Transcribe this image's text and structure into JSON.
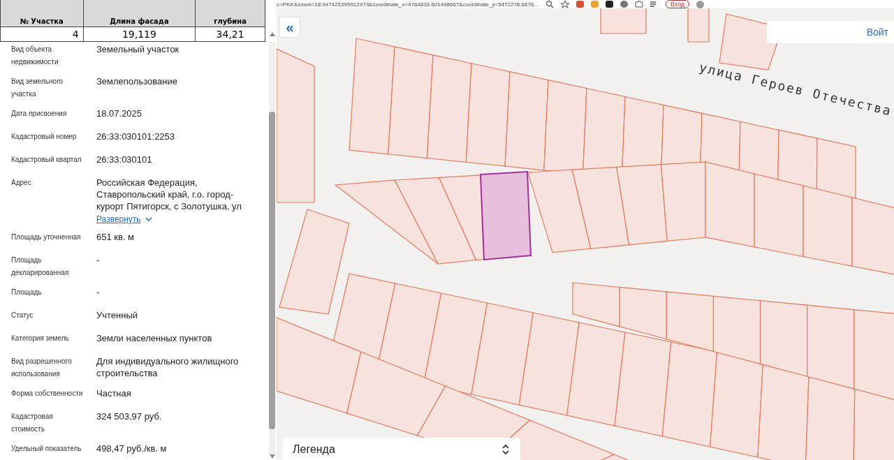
{
  "spreadsheet": {
    "columns": [
      "№ Участка",
      "Длина фасада",
      "глубина"
    ],
    "row": [
      "4",
      "19,119",
      "34,21"
    ]
  },
  "browser": {
    "url": "c=PKK&zoom=18.947425395912973&coordinate_x=4784833.601498667&coordinate_y=5472278.6678...",
    "login_button": "Вход"
  },
  "properties": [
    {
      "label": "Вид объекта недвижимости",
      "value": "Земельный участок"
    },
    {
      "label": "Вид земельного участка",
      "value": "Землепользование"
    },
    {
      "label": "Дата присвоения",
      "value": "18.07.2025"
    },
    {
      "label": "Кадастровый номер",
      "value": "26:33:030101:2253"
    },
    {
      "label": "Кадастровый квартал",
      "value": "26:33:030101"
    },
    {
      "label": "Адрес",
      "value": "Российская Федерация, Ставропольский край, г.о. город-курорт Пятигорск, с Золотушка, ул",
      "link": "Развернуть"
    },
    {
      "label": "Площадь уточненная",
      "value": "651 кв. м"
    },
    {
      "label": "Площадь декларированная",
      "value": "-"
    },
    {
      "label": "Площадь",
      "value": "-"
    },
    {
      "label": "Статус",
      "value": "Учтенный"
    },
    {
      "label": "Категория земель",
      "value": "Земли населенных пунктов"
    },
    {
      "label": "Вид разрешенного использования",
      "value": "Для индивидуального жилищного строительства"
    },
    {
      "label": "Форма собственности",
      "value": "Частная"
    },
    {
      "label": "Кадастровая стоимость",
      "value": "324 503,97 руб."
    },
    {
      "label": "Удельный показатель",
      "value": "498,47 руб./кв. м"
    }
  ],
  "map": {
    "collapse_button": "«",
    "login_button": "Войт",
    "street_label": "улица Героев Отечества",
    "legend": "Легенда"
  }
}
